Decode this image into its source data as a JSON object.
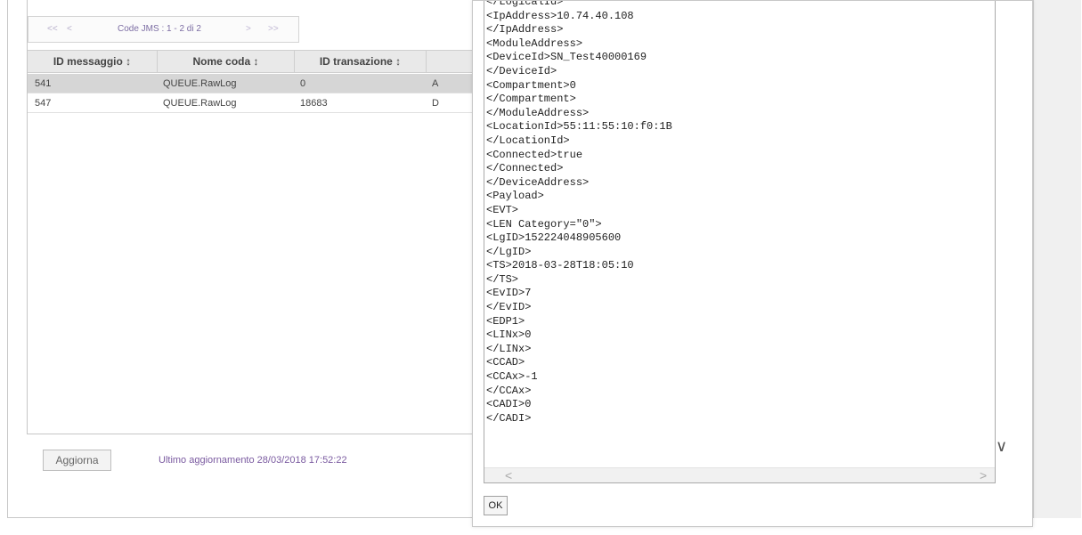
{
  "pager": {
    "first": "<<",
    "prev": "<",
    "label": "Code JMS : 1 - 2 di 2",
    "next": ">",
    "last": ">>"
  },
  "table": {
    "columns": [
      "ID messaggio ↕",
      "Nome coda ↕",
      "ID transazione ↕",
      ""
    ],
    "rows": [
      [
        "541",
        "QUEUE.RawLog",
        "0",
        "A"
      ],
      [
        "547",
        "QUEUE.RawLog",
        "18683",
        "D"
      ]
    ]
  },
  "footer": {
    "refresh_label": "Aggiorna",
    "last_update": "Ultimo aggiornamento 28/03/2018 17:52:22"
  },
  "dialog": {
    "code_lines": [
      "</LogicalId>",
      "<IpAddress>10.74.40.108",
      "</IpAddress>",
      "<ModuleAddress>",
      "<DeviceId>SN_Test40000169",
      "</DeviceId>",
      "<Compartment>0",
      "</Compartment>",
      "</ModuleAddress>",
      "<LocationId>55:11:55:10:f0:1B",
      "</LocationId>",
      "<Connected>true",
      "</Connected>",
      "</DeviceAddress>",
      "<Payload>",
      "<EVT>",
      "<LEN Category=\"0\">",
      "<LgID>152224048905600",
      "</LgID>",
      "<TS>2018-03-28T18:05:10",
      "</TS>",
      "<EvID>7",
      "</EvID>",
      "<EDP1>",
      "<LINx>0",
      "</LINx>",
      "<CCAD>",
      "<CCAx>-1",
      "</CCAx>",
      "<CADI>0",
      "</CADI>"
    ],
    "scroll_left": "<",
    "scroll_right": ">",
    "chevron": "∨",
    "ok_label": "OK"
  }
}
